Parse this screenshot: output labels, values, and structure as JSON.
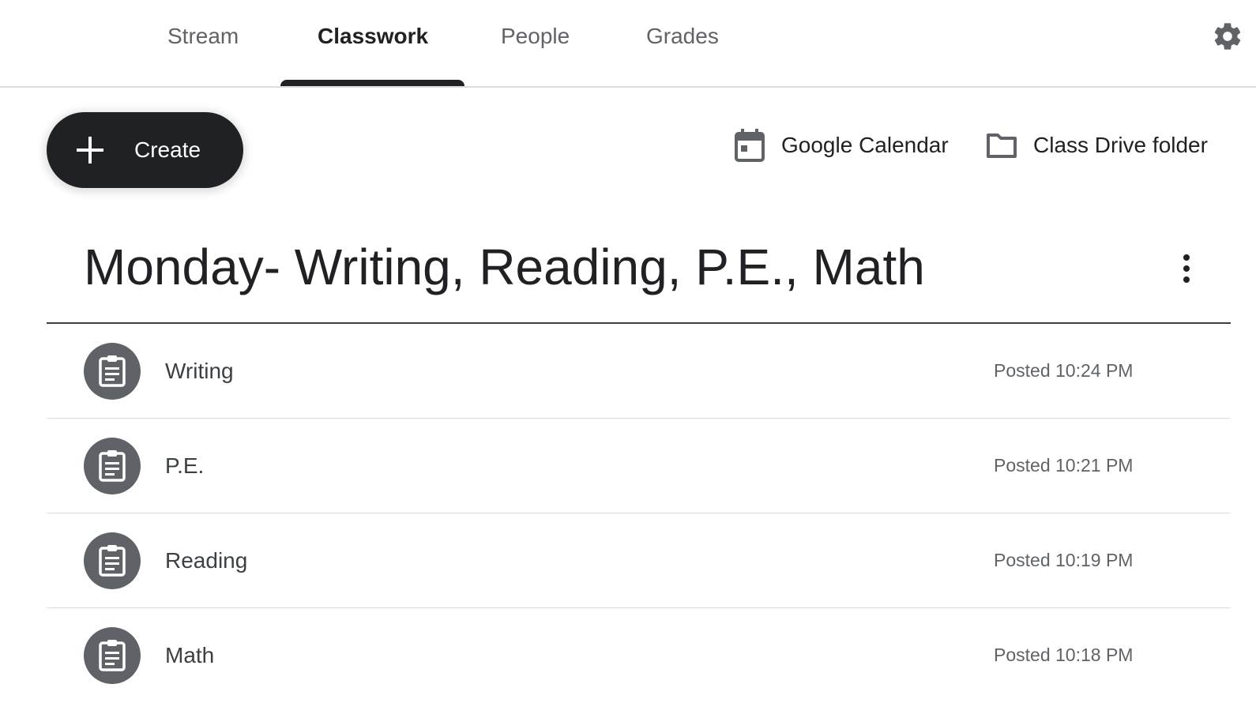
{
  "tabs": [
    {
      "label": "Stream"
    },
    {
      "label": "Classwork",
      "active": true
    },
    {
      "label": "People"
    },
    {
      "label": "Grades"
    }
  ],
  "toolbar": {
    "create_label": "Create",
    "calendar_label": "Google Calendar",
    "drive_label": "Class Drive folder"
  },
  "topic": {
    "title": "Monday- Writing, Reading, P.E., Math",
    "items": [
      {
        "title": "Writing",
        "posted": "Posted 10:24 PM",
        "icon": "assignment-icon"
      },
      {
        "title": "P.E.",
        "posted": "Posted 10:21 PM",
        "icon": "assignment-icon"
      },
      {
        "title": "Reading",
        "posted": "Posted 10:19 PM",
        "icon": "assignment-icon"
      },
      {
        "title": "Math",
        "posted": "Posted 10:18 PM",
        "icon": "assignment-icon"
      }
    ]
  },
  "colors": {
    "primary_dark": "#202124",
    "secondary_text": "#5f6368",
    "badge_bg": "#5f6368",
    "divider": "#dadce0"
  }
}
